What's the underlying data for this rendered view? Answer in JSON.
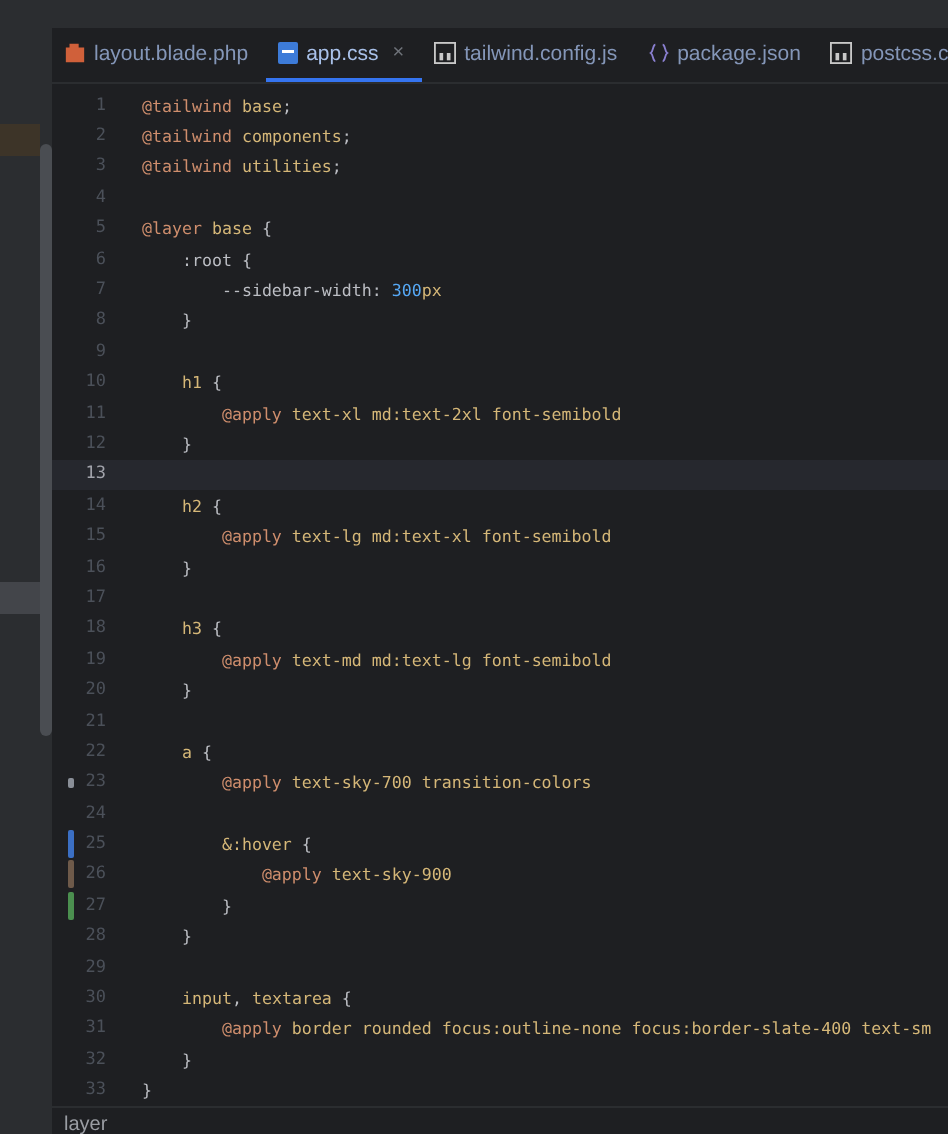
{
  "tabs": [
    {
      "label": "layout.blade.php",
      "kind": "blade",
      "selected": false
    },
    {
      "label": "app.css",
      "kind": "css",
      "selected": true,
      "close": "×"
    },
    {
      "label": "tailwind.config.js",
      "kind": "js",
      "selected": false
    },
    {
      "label": "package.json",
      "kind": "json",
      "selected": false
    },
    {
      "label": "postcss.c",
      "kind": "js",
      "selected": false
    }
  ],
  "lines": [
    {
      "number": "1",
      "current": false,
      "tokens": [
        {
          "kind": "at",
          "text": "@tailwind"
        },
        {
          "kind": "ident",
          "text": " base"
        },
        {
          "kind": "plain",
          "text": ";"
        }
      ]
    },
    {
      "number": "2",
      "current": false,
      "tokens": [
        {
          "kind": "at",
          "text": "@tailwind"
        },
        {
          "kind": "ident",
          "text": " components"
        },
        {
          "kind": "plain",
          "text": ";"
        }
      ]
    },
    {
      "number": "3",
      "current": false,
      "tokens": [
        {
          "kind": "at",
          "text": "@tailwind"
        },
        {
          "kind": "ident",
          "text": " utilities"
        },
        {
          "kind": "plain",
          "text": ";"
        }
      ]
    },
    {
      "number": "4",
      "current": false
    },
    {
      "number": "5",
      "current": false,
      "tokens": [
        {
          "kind": "at",
          "text": "@layer"
        },
        {
          "kind": "ident",
          "text": " base"
        },
        {
          "kind": "plain",
          "text": " {"
        }
      ]
    },
    {
      "number": "6",
      "current": false,
      "tokens": [
        {
          "kind": "plain",
          "text": "    :root {"
        }
      ]
    },
    {
      "number": "7",
      "current": false,
      "tokens": [
        {
          "kind": "plain",
          "text": "        --sidebar-width: "
        },
        {
          "kind": "num",
          "text": "300"
        },
        {
          "kind": "ident",
          "text": "px"
        }
      ]
    },
    {
      "number": "8",
      "current": false,
      "tokens": [
        {
          "kind": "plain",
          "text": "    }"
        }
      ]
    },
    {
      "number": "9",
      "current": false
    },
    {
      "number": "10",
      "current": false,
      "tokens": [
        {
          "kind": "ident",
          "text": "    h1"
        },
        {
          "kind": "plain",
          "text": " {"
        }
      ]
    },
    {
      "number": "11",
      "current": false,
      "tokens": [
        {
          "kind": "at",
          "text": "        @apply"
        },
        {
          "kind": "ident",
          "text": " text-xl md:text-2xl font-semibold"
        }
      ]
    },
    {
      "number": "12",
      "current": false,
      "tokens": [
        {
          "kind": "plain",
          "text": "    }"
        }
      ]
    },
    {
      "number": "13",
      "current": true
    },
    {
      "number": "14",
      "current": false,
      "tokens": [
        {
          "kind": "ident",
          "text": "    h2"
        },
        {
          "kind": "plain",
          "text": " {"
        }
      ]
    },
    {
      "number": "15",
      "current": false,
      "tokens": [
        {
          "kind": "at",
          "text": "        @apply"
        },
        {
          "kind": "ident",
          "text": " text-lg md:text-xl font-semibold"
        }
      ]
    },
    {
      "number": "16",
      "current": false,
      "tokens": [
        {
          "kind": "plain",
          "text": "    }"
        }
      ]
    },
    {
      "number": "17",
      "current": false
    },
    {
      "number": "18",
      "current": false,
      "tokens": [
        {
          "kind": "ident",
          "text": "    h3"
        },
        {
          "kind": "plain",
          "text": " {"
        }
      ]
    },
    {
      "number": "19",
      "current": false,
      "tokens": [
        {
          "kind": "at",
          "text": "        @apply"
        },
        {
          "kind": "ident",
          "text": " text-md md:text-lg font-semibold"
        }
      ]
    },
    {
      "number": "20",
      "current": false,
      "tokens": [
        {
          "kind": "plain",
          "text": "    }"
        }
      ]
    },
    {
      "number": "21",
      "current": false
    },
    {
      "number": "22",
      "current": false,
      "tokens": [
        {
          "kind": "ident",
          "text": "    a"
        },
        {
          "kind": "plain",
          "text": " {"
        }
      ]
    },
    {
      "number": "23",
      "current": false,
      "color": "#8a8f98",
      "tokens": [
        {
          "kind": "at",
          "text": "        @apply"
        },
        {
          "kind": "ident",
          "text": " text-sky-700 transition-colors"
        }
      ]
    },
    {
      "number": "24",
      "current": false
    },
    {
      "number": "25",
      "current": false,
      "color": "#3b6fc4",
      "tokens": [
        {
          "kind": "ident",
          "text": "        &:hover"
        },
        {
          "kind": "plain",
          "text": " {"
        }
      ]
    },
    {
      "number": "26",
      "current": false,
      "color": "#6e5a4a",
      "tokens": [
        {
          "kind": "at",
          "text": "            @apply"
        },
        {
          "kind": "ident",
          "text": " text-sky-900"
        }
      ]
    },
    {
      "number": "27",
      "current": false,
      "color": "#4b8f4f",
      "tokens": [
        {
          "kind": "plain",
          "text": "        }"
        }
      ]
    },
    {
      "number": "28",
      "current": false,
      "tokens": [
        {
          "kind": "plain",
          "text": "    }"
        }
      ]
    },
    {
      "number": "29",
      "current": false
    },
    {
      "number": "30",
      "current": false,
      "tokens": [
        {
          "kind": "ident",
          "text": "    input"
        },
        {
          "kind": "plain",
          "text": ", "
        },
        {
          "kind": "ident",
          "text": "textarea"
        },
        {
          "kind": "plain",
          "text": " {"
        }
      ]
    },
    {
      "number": "31",
      "current": false,
      "tokens": [
        {
          "kind": "at",
          "text": "        @apply"
        },
        {
          "kind": "ident",
          "text": " border rounded focus:outline-none focus:border-slate-400 text-sm"
        }
      ]
    },
    {
      "number": "32",
      "current": false,
      "tokens": [
        {
          "kind": "plain",
          "text": "    }"
        }
      ]
    },
    {
      "number": "33",
      "current": false,
      "tokens": [
        {
          "kind": "plain",
          "text": "}"
        }
      ]
    }
  ],
  "breadcrumb": "layer"
}
